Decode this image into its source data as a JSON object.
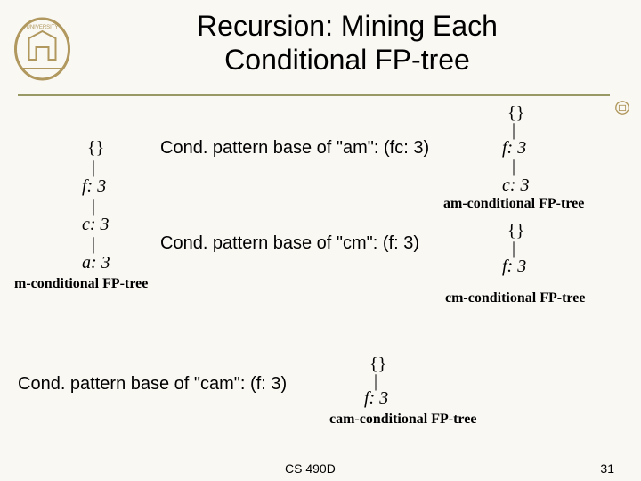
{
  "title": "Recursion: Mining Each Conditional FP-tree",
  "cond_am": "Cond. pattern base of \"am\": (fc: 3)",
  "cond_cm": "Cond. pattern base of \"cm\": (f: 3)",
  "cond_cam": "Cond. pattern base of \"cam\": (f: 3)",
  "caption_m": "m-conditional FP-tree",
  "caption_am": "am-conditional FP-tree",
  "caption_cm": "cm-conditional FP-tree",
  "caption_cam": "cam-conditional FP-tree",
  "root": "{}",
  "nodes": {
    "f3": "f: 3",
    "c3": "c: 3",
    "a3": "a: 3"
  },
  "footer": "CS 490D",
  "page": "31"
}
